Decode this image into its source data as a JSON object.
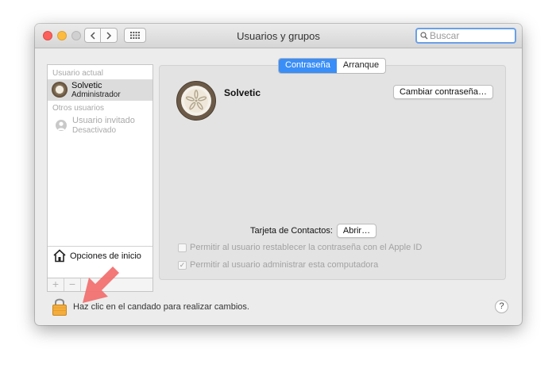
{
  "window": {
    "title": "Usuarios y grupos"
  },
  "search": {
    "placeholder": "Buscar"
  },
  "sidebar": {
    "current_header": "Usuario actual",
    "current_user": {
      "name": "Solvetic",
      "role": "Administrador"
    },
    "other_header": "Otros usuarios",
    "guest": {
      "name": "Usuario invitado",
      "status": "Desactivado"
    },
    "login_options": "Opciones de inicio",
    "add_symbol": "+",
    "remove_symbol": "−"
  },
  "tabs": [
    {
      "label": "Contraseña",
      "active": true
    },
    {
      "label": "Arranque",
      "active": false
    }
  ],
  "account": {
    "name": "Solvetic",
    "change_password_button": "Cambiar contraseña…",
    "contact_card_label": "Tarjeta de Contactos:",
    "open_button": "Abrir…",
    "option_reset_apple_id": "Permitir al usuario restablecer la contraseña con el Apple ID",
    "option_reset_checked": false,
    "option_admin": "Permitir al usuario administrar esta computadora",
    "option_admin_checked": true
  },
  "footer": {
    "lock_text": "Haz clic en el candado para realizar cambios.",
    "help_symbol": "?"
  },
  "colors": {
    "accent": "#3a8ef7",
    "annotation_arrow": "#f26d6d"
  },
  "icons": [
    "back-icon",
    "forward-icon",
    "grid-icon",
    "search-icon",
    "home-icon",
    "lock-icon",
    "user-icon",
    "sand-dollar-icon",
    "arrow-annotation-icon"
  ]
}
